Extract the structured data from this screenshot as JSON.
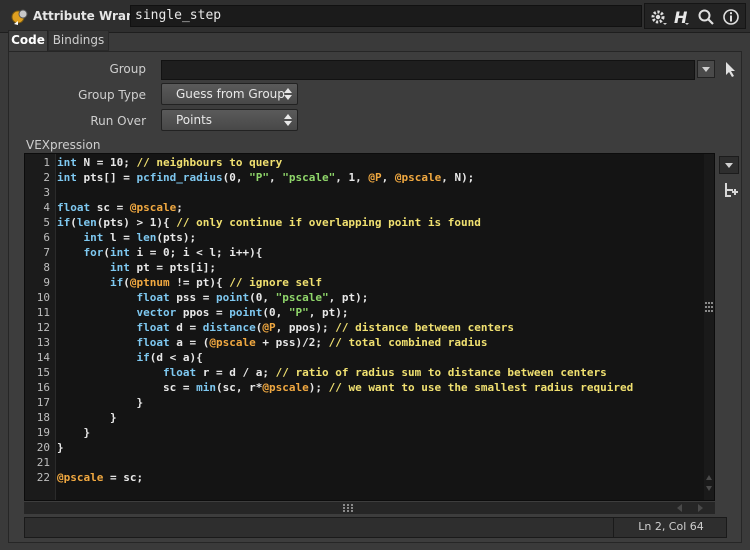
{
  "titlebar": {
    "node_type": "Attribute Wrangle",
    "node_name": "single_step",
    "icons": [
      "gear-icon",
      "help-h-icon",
      "search-icon",
      "info-icon"
    ]
  },
  "tabs": [
    {
      "label": "Code",
      "active": true
    },
    {
      "label": "Bindings",
      "active": false
    }
  ],
  "parms": {
    "group_label": "Group",
    "group_value": "",
    "group_type_label": "Group Type",
    "group_type_value": "Guess from Group",
    "run_over_label": "Run Over",
    "run_over_value": "Points",
    "vex_label": "VEXpression"
  },
  "editor": {
    "line_numbers": [
      "1",
      "2",
      "3",
      "4",
      "5",
      "6",
      "7",
      "8",
      "9",
      "10",
      "11",
      "12",
      "13",
      "14",
      "15",
      "16",
      "17",
      "18",
      "19",
      "20",
      "21",
      "22"
    ],
    "lines": [
      "int N = 10; // neighbours to query",
      "int pts[] = pcfind_radius(0, \"P\", \"pscale\", 1, @P, @pscale, N);",
      "",
      "float sc = @pscale;",
      "if(len(pts) > 1){ // only continue if overlapping point is found",
      "    int l = len(pts);",
      "    for(int i = 0; i < l; i++){",
      "        int pt = pts[i];",
      "        if(@ptnum != pt){ // ignore self",
      "            float pss = point(0, \"pscale\", pt);",
      "            vector ppos = point(0, \"P\", pt);",
      "            float d = distance(@P, ppos); // distance between centers",
      "            float a = (@pscale + pss)/2; // total combined radius",
      "            if(d < a){",
      "                float r = d / a; // ratio of radius sum to distance between centers",
      "                sc = min(sc, r*@pscale); // we want to use the smallest radius required",
      "            }",
      "        }",
      "    }",
      "}",
      "",
      "@pscale = sc;"
    ]
  },
  "status": {
    "message": "",
    "cursor_position": "Ln 2, Col 64"
  },
  "colors": {
    "keyword": "#7ec8f0",
    "comment": "#f0e070",
    "string": "#8fd66a",
    "attribute": "#f0a840",
    "default": "#e8e8e8"
  }
}
